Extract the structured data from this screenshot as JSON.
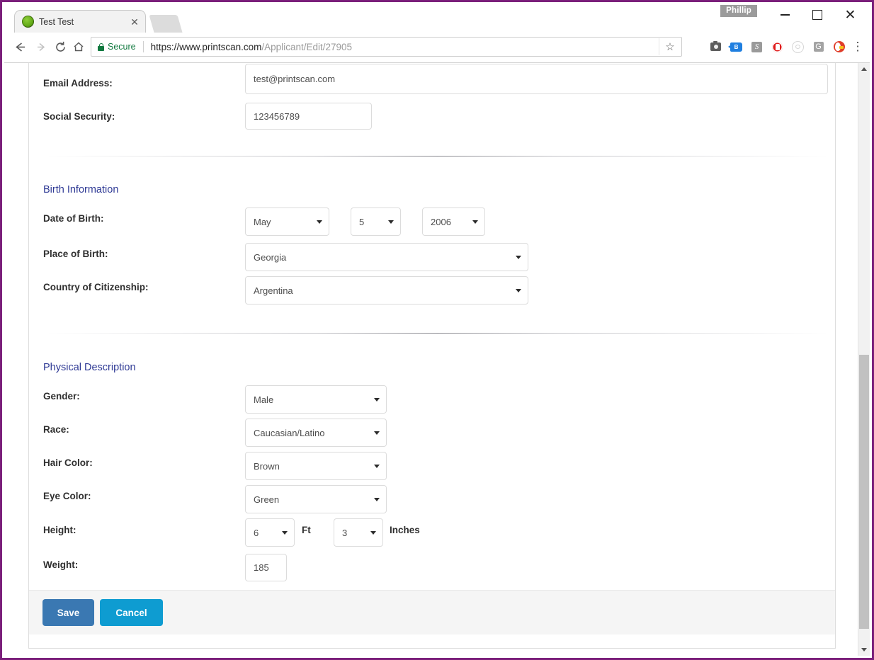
{
  "browser": {
    "tab": {
      "title": "Test Test",
      "favicon": "globe-green-icon",
      "close_label": "✕"
    },
    "profile_badge": "Phillip",
    "window_controls": {
      "minimize": "–",
      "maximize": "□",
      "close": "✕"
    },
    "nav": {
      "back": "←",
      "forward": "→",
      "reload": "↻",
      "home": "⌂"
    },
    "omnibox": {
      "security_label": "Secure",
      "url_host": "https://www.printscan.com",
      "url_path": "/Applicant/Edit/27905",
      "bookmark_star": "☆"
    },
    "extensions": [
      {
        "name": "camera-icon",
        "label": ""
      },
      {
        "name": "tag-icon",
        "label": "B"
      },
      {
        "name": "script-s-icon",
        "label": "S"
      },
      {
        "name": "adblock-stop-icon",
        "label": ""
      },
      {
        "name": "disabled-circle-icon",
        "label": ""
      },
      {
        "name": "google-g-icon",
        "label": "G"
      },
      {
        "name": "duckduckgo-icon",
        "label": ""
      }
    ],
    "menu": "⋮"
  },
  "theme": {
    "window_border": "#7b1f7b",
    "section_heading": "#2f3a95",
    "save_button": "#3a78b2",
    "cancel_button": "#0e9cd1",
    "footer_bg": "#f5f5f5",
    "input_border": "#dcdcdc"
  },
  "form": {
    "fields": {
      "email": {
        "label": "Email Address:",
        "value": "test@printscan.com",
        "placeholder": "Email Address"
      },
      "ssn": {
        "label": "Social Security:",
        "value": "123456789",
        "placeholder": "Social Security"
      }
    },
    "sections": [
      {
        "title": "Birth Information",
        "rows": [
          {
            "label": "Date of Birth:",
            "controls": [
              {
                "name": "dob-month-select",
                "value": "May"
              },
              {
                "name": "dob-day-select",
                "value": "5"
              },
              {
                "name": "dob-year-select",
                "value": "2006"
              }
            ]
          },
          {
            "label": "Place of Birth:",
            "controls": [
              {
                "name": "place-of-birth-select",
                "value": "Georgia"
              }
            ]
          },
          {
            "label": "Country of Citizenship:",
            "controls": [
              {
                "name": "citizenship-select",
                "value": "Argentina"
              }
            ]
          }
        ]
      },
      {
        "title": "Physical Description",
        "rows": [
          {
            "label": "Gender:",
            "controls": [
              {
                "name": "gender-select",
                "value": "Male"
              }
            ]
          },
          {
            "label": "Race:",
            "controls": [
              {
                "name": "race-select",
                "value": "Caucasian/Latino"
              }
            ]
          },
          {
            "label": "Hair Color:",
            "controls": [
              {
                "name": "hair-color-select",
                "value": "Brown"
              }
            ]
          },
          {
            "label": "Eye Color:",
            "controls": [
              {
                "name": "eye-color-select",
                "value": "Green"
              }
            ]
          },
          {
            "label": "Height:",
            "controls": [
              {
                "name": "height-feet-select",
                "value": "6",
                "unit": "Ft"
              },
              {
                "name": "height-inches-select",
                "value": "3",
                "unit": "Inches"
              }
            ]
          },
          {
            "label": "Weight:",
            "controls": [
              {
                "name": "weight-input",
                "value": "185"
              }
            ]
          }
        ]
      }
    ],
    "buttons": {
      "save": "Save",
      "cancel": "Cancel"
    }
  }
}
